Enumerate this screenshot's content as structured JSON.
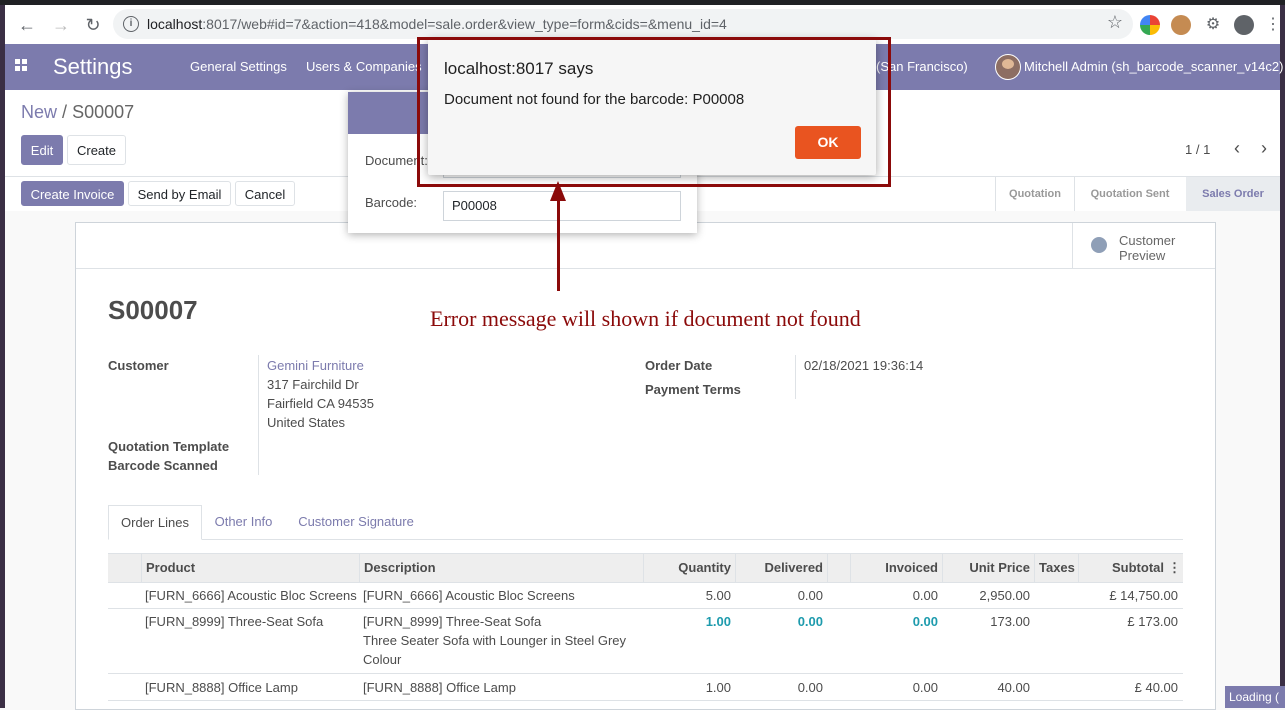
{
  "browser": {
    "url_host": "localhost",
    "url_rest": ":8017/web#id=7&action=418&model=sale.order&view_type=form&cids=&menu_id=4"
  },
  "navbar": {
    "app_title": "Settings",
    "menu": [
      "General Settings",
      "Users & Companies"
    ],
    "company": "(San Francisco)",
    "user": "Mitchell Admin (sh_barcode_scanner_v14c2)"
  },
  "control_panel": {
    "breadcrumb_parent": "New",
    "breadcrumb_sep": "/",
    "breadcrumb_current": "S00007",
    "edit_label": "Edit",
    "create_label": "Create",
    "pager": "1 / 1"
  },
  "statusbar": {
    "buttons": [
      "Create Invoice",
      "Send by Email",
      "Cancel"
    ],
    "stages": [
      "Quotation",
      "Quotation Sent",
      "Sales Order"
    ]
  },
  "form": {
    "smart_button": "Customer Preview",
    "title": "S00007",
    "customer_label": "Customer",
    "customer_name": "Gemini Furniture",
    "customer_address": [
      "317 Fairchild Dr",
      "Fairfield CA 94535",
      "United States"
    ],
    "quotation_template_label": "Quotation Template",
    "barcode_scanned_label": "Barcode Scanned",
    "order_date_label": "Order Date",
    "order_date": "02/18/2021 19:36:14",
    "payment_terms_label": "Payment Terms",
    "tabs": [
      "Order Lines",
      "Other Info",
      "Customer Signature"
    ]
  },
  "table": {
    "headers": [
      "Product",
      "Description",
      "Quantity",
      "Delivered",
      "Invoiced",
      "Unit Price",
      "Taxes",
      "Subtotal"
    ],
    "rows": [
      {
        "product": "[FURN_6666] Acoustic Bloc Screens",
        "description": [
          "[FURN_6666] Acoustic Bloc Screens"
        ],
        "quantity": "5.00",
        "delivered": "0.00",
        "invoiced": "0.00",
        "unit_price": "2,950.00",
        "subtotal": "£ 14,750.00"
      },
      {
        "product": "[FURN_8999] Three-Seat Sofa",
        "description": [
          "[FURN_8999] Three-Seat Sofa",
          "Three Seater Sofa with Lounger in Steel Grey",
          "Colour"
        ],
        "quantity": "1.00",
        "delivered": "0.00",
        "invoiced": "0.00",
        "unit_price": "173.00",
        "subtotal": "£ 173.00"
      },
      {
        "product": "[FURN_8888] Office Lamp",
        "description": [
          "[FURN_8888] Office Lamp"
        ],
        "quantity": "1.00",
        "delivered": "0.00",
        "invoiced": "0.00",
        "unit_price": "40.00",
        "subtotal": "£ 40.00"
      }
    ]
  },
  "dialog": {
    "document_label": "Document:",
    "barcode_label": "Barcode:",
    "barcode_value": "P00008"
  },
  "alert": {
    "title": "localhost:8017 says",
    "message": "Document not found for the barcode: P00008",
    "ok_label": "OK"
  },
  "annotation": "Error message will shown if document not found",
  "loading": "Loading (",
  "colors": {
    "brand": "#7c7bad",
    "annotation": "#8b0a0a",
    "ok_button": "#e95420"
  }
}
